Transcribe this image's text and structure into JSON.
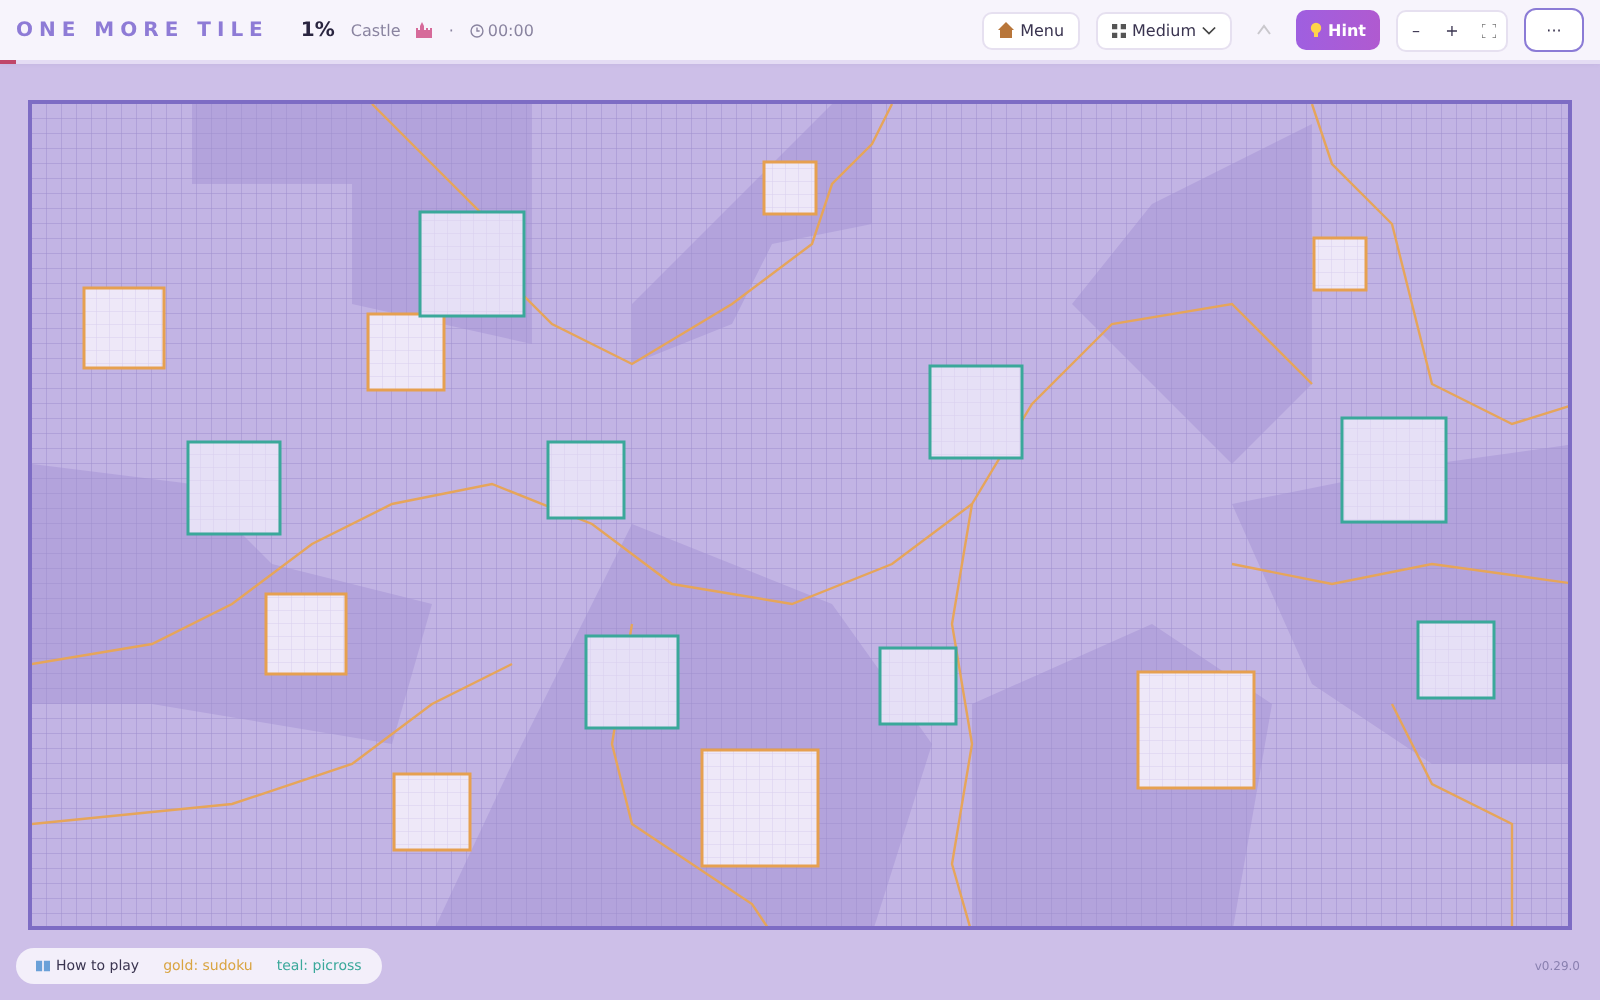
{
  "header": {
    "title": "ONE MORE TILE",
    "percent": "1%",
    "level_name": "Castle",
    "separator": "·",
    "timer": "00:00"
  },
  "progress": {
    "level": 0.01
  },
  "toolbar": {
    "menu": "Menu",
    "difficulty": "Medium",
    "undo": {
      "disabled": true
    },
    "hint": "Hint",
    "zoom_out": "–",
    "zoom_in": "+",
    "more": "···"
  },
  "legend": {
    "how_to_play": "How to play",
    "items": [
      {
        "label": "gold: sudoku",
        "color": "#d9a440"
      },
      {
        "label": "teal: picross",
        "color": "#3aa89a"
      }
    ]
  },
  "version": "v0.29.0"
}
